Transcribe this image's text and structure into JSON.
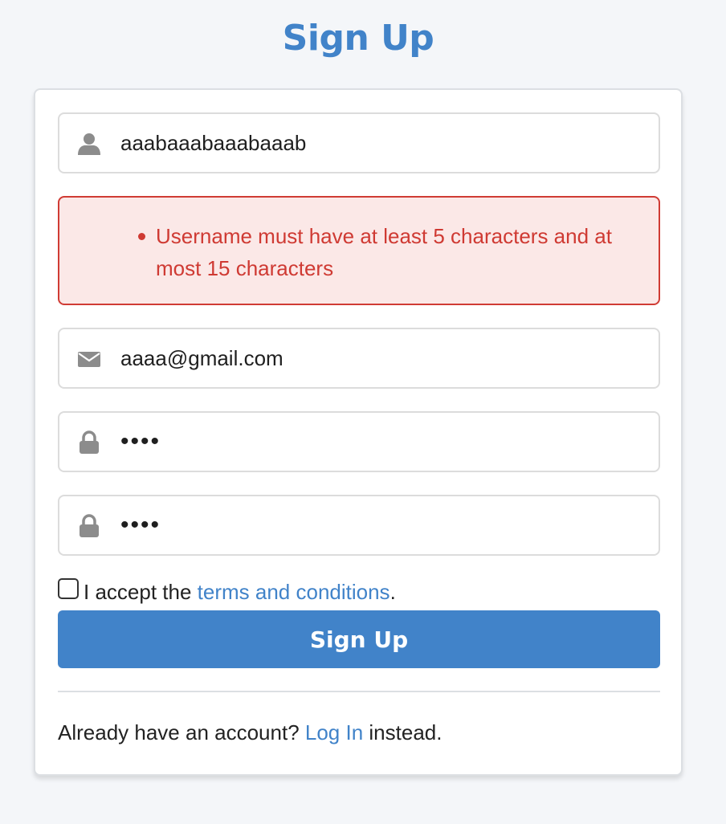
{
  "page": {
    "title": "Sign Up"
  },
  "form": {
    "username": {
      "icon": "user-icon",
      "value": "aaabaaabaaabaaab"
    },
    "errors": [
      "Username must have at least 5 characters and at most 15 characters"
    ],
    "email": {
      "icon": "envelope-icon",
      "value": "aaaa@gmail.com"
    },
    "password": {
      "icon": "lock-icon",
      "value": "••••"
    },
    "confirm_password": {
      "icon": "lock-icon",
      "value": "••••"
    },
    "terms": {
      "checked": false,
      "prefix": "I accept the ",
      "link": "terms and conditions",
      "suffix": "."
    },
    "submit_label": "Sign Up"
  },
  "footer": {
    "prefix": "Already have an account? ",
    "link": "Log In",
    "suffix": " instead."
  },
  "colors": {
    "accent": "#4183c9",
    "error_text": "#cf3a33",
    "error_bg": "#fbe8e7",
    "icon": "#8c8c8c"
  }
}
